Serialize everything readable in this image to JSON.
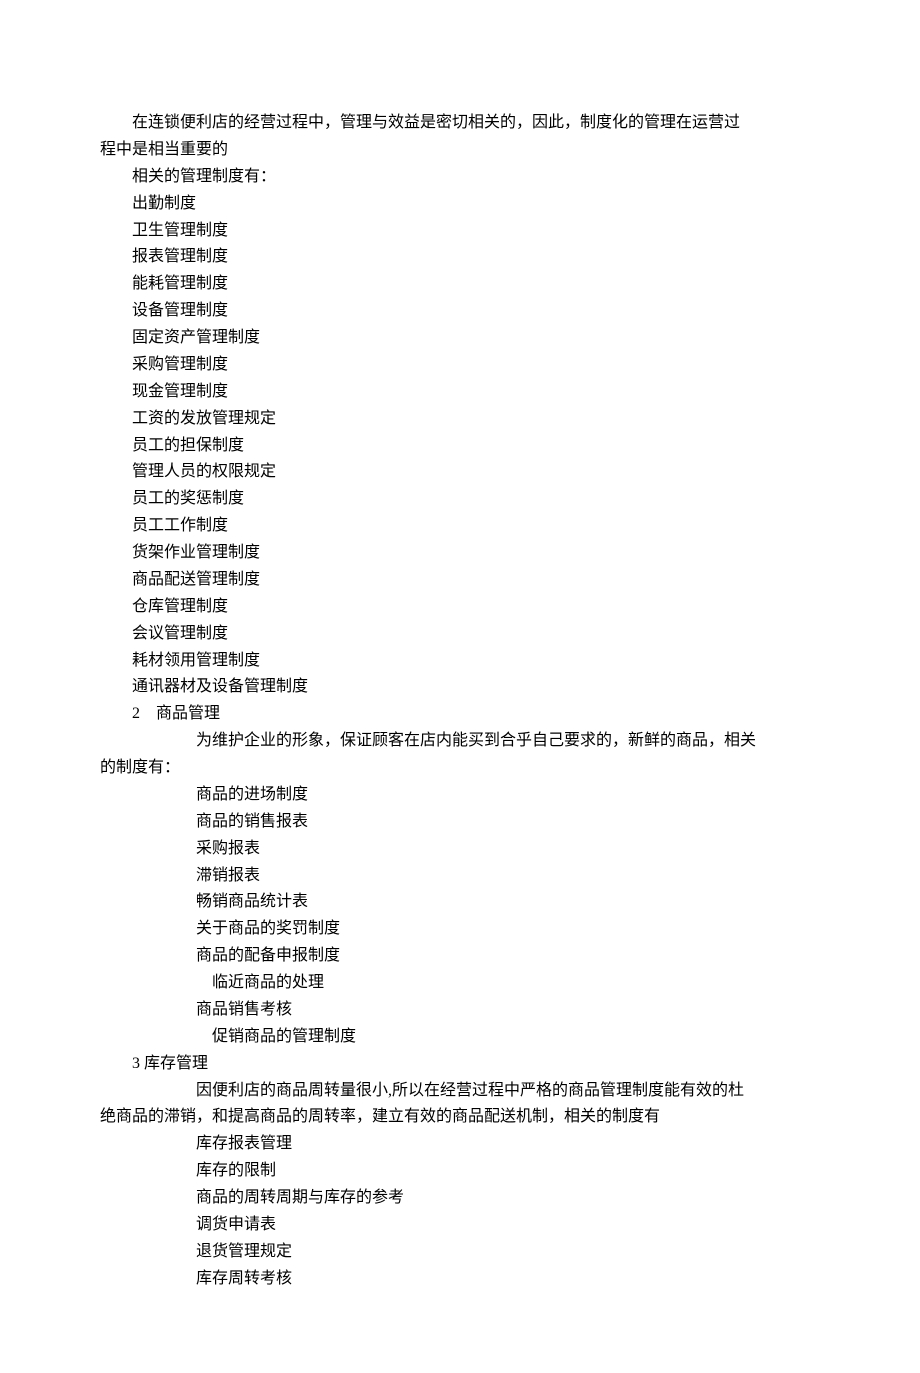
{
  "intro": {
    "p1_first": "在连锁便利店的经营过程中，管理与效益是密切相关的，因此，制度化的管理在运营过",
    "p1_cont": "程中是相当重要的",
    "p2": "相关的管理制度有："
  },
  "section1_items": [
    "出勤制度",
    "卫生管理制度",
    "报表管理制度",
    "能耗管理制度",
    "设备管理制度",
    "固定资产管理制度",
    "采购管理制度",
    "现金管理制度",
    "工资的发放管理规定",
    "员工的担保制度",
    "管理人员的权限规定",
    "员工的奖惩制度",
    "员工工作制度",
    "货架作业管理制度",
    "商品配送管理制度",
    "仓库管理制度",
    "会议管理制度",
    "耗材领用管理制度",
    "通讯器材及设备管理制度"
  ],
  "section2": {
    "heading": "2　商品管理",
    "intro_first": "为维护企业的形象，保证顾客在店内能买到合乎自己要求的，新鲜的商品，相关",
    "intro_cont": "的制度有：",
    "items": [
      {
        "t": "商品的进场制度",
        "lvl": 2
      },
      {
        "t": "商品的销售报表",
        "lvl": 2
      },
      {
        "t": "采购报表",
        "lvl": 2
      },
      {
        "t": "滞销报表",
        "lvl": 2
      },
      {
        "t": "畅销商品统计表",
        "lvl": 2
      },
      {
        "t": "关于商品的奖罚制度",
        "lvl": 2
      },
      {
        "t": "商品的配备申报制度",
        "lvl": 2
      },
      {
        "t": "临近商品的处理",
        "lvl": 3
      },
      {
        "t": "商品销售考核",
        "lvl": 2
      },
      {
        "t": "促销商品的管理制度",
        "lvl": 3
      }
    ]
  },
  "section3": {
    "heading": "3 库存管理",
    "intro_first": "因便利店的商品周转量很小,所以在经营过程中严格的商品管理制度能有效的杜",
    "intro_cont": "绝商品的滞销，和提高商品的周转率，建立有效的商品配送机制，相关的制度有",
    "items": [
      "库存报表管理",
      "库存的限制",
      "商品的周转周期与库存的参考",
      "调货申请表",
      "退货管理规定",
      "库存周转考核"
    ]
  }
}
